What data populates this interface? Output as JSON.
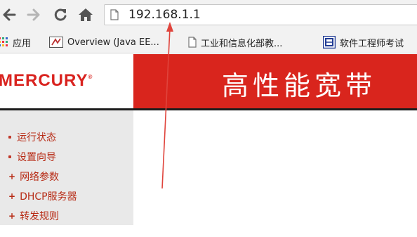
{
  "browser": {
    "address_bar": {
      "url": "192.168.1.1"
    },
    "icons": {
      "back": "back-arrow-icon",
      "forward": "forward-arrow-icon",
      "reload": "reload-icon",
      "home": "home-icon",
      "page": "page-icon"
    },
    "bookmarks": [
      {
        "label": "应用",
        "icon": "apps-grid-icon"
      },
      {
        "label": "Overview (Java EE...",
        "icon": "java-icon"
      },
      {
        "label": "工业和信息化部教...",
        "icon": "page-icon"
      },
      {
        "label": "软件工程师考试",
        "icon": "bai-icon"
      }
    ]
  },
  "router_page": {
    "logo": "MERCURY",
    "logo_mark": "®",
    "banner_title": "高性能宽带",
    "menu": [
      {
        "label": "运行状态",
        "marker": "bullet"
      },
      {
        "label": "设置向导",
        "marker": "bullet"
      },
      {
        "label": "网络参数",
        "marker": "plus"
      },
      {
        "label": "DHCP服务器",
        "marker": "plus"
      },
      {
        "label": "转发规则",
        "marker": "plus"
      }
    ]
  },
  "colors": {
    "brand_red": "#d9251d",
    "menu_text": "#b72a14",
    "annotation_arrow": "#e0443c"
  }
}
